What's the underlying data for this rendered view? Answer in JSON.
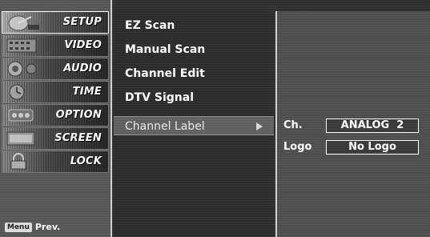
{
  "sidebar": {
    "items": [
      {
        "label": "SETUP",
        "icon": "satellite-dish-icon"
      },
      {
        "label": "VIDEO",
        "icon": "film-icon"
      },
      {
        "label": "AUDIO",
        "icon": "speaker-icon"
      },
      {
        "label": "TIME",
        "icon": "clock-icon"
      },
      {
        "label": "OPTION",
        "icon": "option-icon"
      },
      {
        "label": "SCREEN",
        "icon": "screen-icon"
      },
      {
        "label": "LOCK",
        "icon": "lock-icon"
      }
    ],
    "selected": "SETUP",
    "footer": {
      "key_label": "Menu",
      "action_label": "Prev."
    }
  },
  "submenu": {
    "items": [
      {
        "label": "EZ Scan"
      },
      {
        "label": "Manual Scan"
      },
      {
        "label": "Channel Edit"
      },
      {
        "label": "DTV Signal"
      },
      {
        "label": "Channel Label"
      }
    ],
    "active": "Channel Label"
  },
  "detail": {
    "rows": [
      {
        "label": "Ch.",
        "value": "ANALOG  2"
      },
      {
        "label": "Logo",
        "value": "No Logo"
      }
    ]
  },
  "colors": {
    "background": "#2e2e2e",
    "sidebar": "#555555",
    "detail_panel": "#4d4d4d",
    "text": "#ffffff",
    "border": "#d0d0d0"
  }
}
